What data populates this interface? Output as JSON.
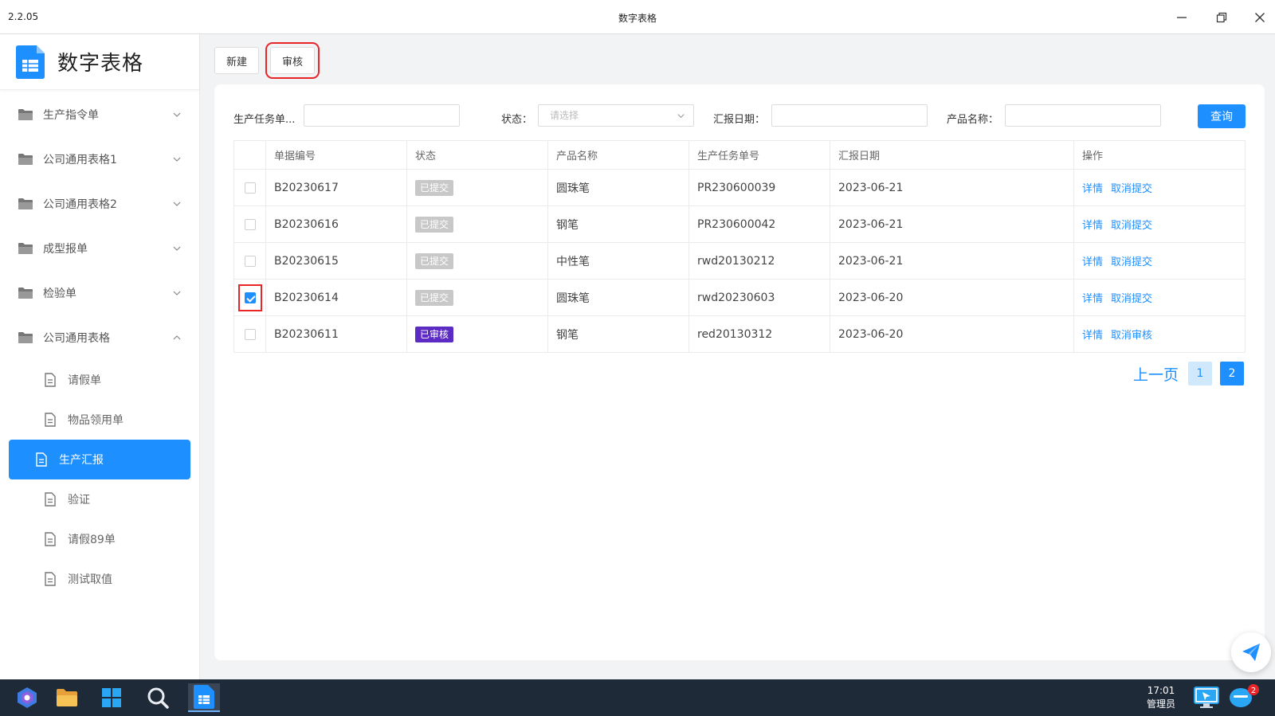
{
  "window": {
    "version": "2.2.05",
    "title": "数字表格"
  },
  "brand": {
    "title": "数字表格"
  },
  "sidebar": {
    "groups": [
      {
        "label": "生产指令单"
      },
      {
        "label": "公司通用表格1"
      },
      {
        "label": "公司通用表格2"
      },
      {
        "label": "成型报单"
      },
      {
        "label": "检验单"
      },
      {
        "label": "公司通用表格"
      }
    ],
    "subitems": [
      {
        "label": "请假单"
      },
      {
        "label": "物品领用单"
      },
      {
        "label": "生产汇报"
      },
      {
        "label": "验证"
      },
      {
        "label": "请假89单"
      },
      {
        "label": "测试取值"
      }
    ]
  },
  "toolbar": {
    "new_label": "新建",
    "audit_label": "审核"
  },
  "filters": {
    "task_no_label": "生产任务单...",
    "status_label": "状态：",
    "status_placeholder": "请选择",
    "date_label": "汇报日期：",
    "product_label": "产品名称：",
    "query_label": "查询"
  },
  "table": {
    "headers": [
      "单据编号",
      "状态",
      "产品名称",
      "生产任务单号",
      "汇报日期",
      "操作"
    ],
    "rows": [
      {
        "code": "B20230617",
        "status": "已提交",
        "product": "圆珠笔",
        "task": "PR230600039",
        "date": "2023-06-21",
        "op1": "详情",
        "op2": "取消提交"
      },
      {
        "code": "B20230616",
        "status": "已提交",
        "product": "钢笔",
        "task": "PR230600042",
        "date": "2023-06-21",
        "op1": "详情",
        "op2": "取消提交"
      },
      {
        "code": "B20230615",
        "status": "已提交",
        "product": "中性笔",
        "task": "rwd20130212",
        "date": "2023-06-21",
        "op1": "详情",
        "op2": "取消提交"
      },
      {
        "code": "B20230614",
        "status": "已提交",
        "product": "圆珠笔",
        "task": "rwd20230603",
        "date": "2023-06-20",
        "op1": "详情",
        "op2": "取消提交"
      },
      {
        "code": "B20230611",
        "status": "已审核",
        "product": "钢笔",
        "task": "red20130312",
        "date": "2023-06-20",
        "op1": "详情",
        "op2": "取消审核"
      }
    ]
  },
  "pager": {
    "prev_label": "上一页",
    "page1": "1",
    "page2": "2"
  },
  "taskbar": {
    "time": "17:01",
    "user": "管理员",
    "notify_count": "2"
  },
  "colors": {
    "accent": "#1e8fff",
    "audited_badge": "#5b2bc4",
    "submitted_badge": "#c8c8c8",
    "highlight": "#e8262a"
  }
}
